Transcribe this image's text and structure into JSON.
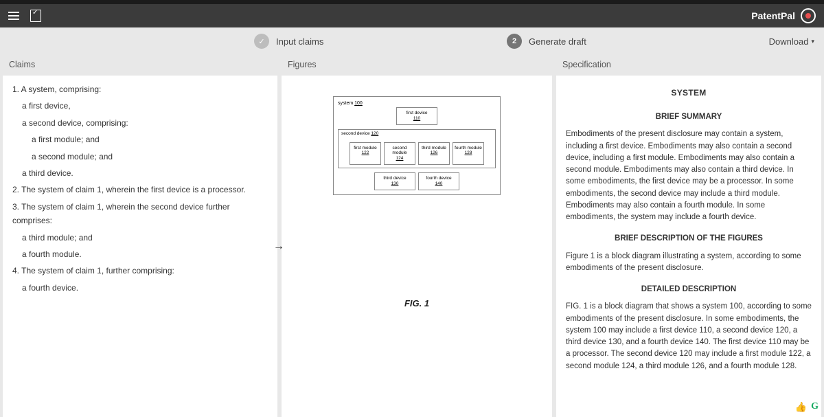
{
  "app": {
    "brand": "PatentPal"
  },
  "stepper": {
    "step1": {
      "label": "Input claims",
      "state": "done",
      "check": "✓"
    },
    "step2": {
      "label": "Generate draft",
      "state": "current",
      "number": "2"
    },
    "download": "Download"
  },
  "columns": {
    "claims_header": "Claims",
    "figures_header": "Figures",
    "spec_header": "Specification"
  },
  "claims": {
    "l1": "1. A system, comprising:",
    "l2": "a first device,",
    "l3": "a second device, comprising:",
    "l4": "a first module; and",
    "l5": "a second module; and",
    "l6": "a third device.",
    "l7": "2. The system of claim 1, wherein the first device is a processor.",
    "l8": "3. The system of claim 1, wherein the second device further comprises:",
    "l9": "a third module; and",
    "l10": "a fourth module.",
    "l11": "4. The system of claim 1, further comprising:",
    "l12": "a fourth device."
  },
  "figure": {
    "system_label": "system",
    "system_ref": "100",
    "first_device": "first device",
    "first_device_ref": "110",
    "second_device_label": "second device",
    "second_device_ref": "120",
    "m1": "first module",
    "m1r": "122",
    "m2": "second module",
    "m2r": "124",
    "m3": "third module",
    "m3r": "126",
    "m4": "fourth module",
    "m4r": "128",
    "third_device": "third device",
    "third_device_ref": "130",
    "fourth_device": "fourth device",
    "fourth_device_ref": "140",
    "caption": "FIG. 1"
  },
  "spec": {
    "title": "SYSTEM",
    "h_summary": "BRIEF SUMMARY",
    "summary": "Embodiments of the present disclosure may contain a system, including a first device. Embodiments may also contain a second device, including a first module. Embodiments may also contain a second module. Embodiments may also contain a third device. In some embodiments, the first device may be a processor. In some embodiments, the second device may include a third module. Embodiments may also contain a fourth module. In some embodiments, the system may include a fourth device.",
    "h_figures": "BRIEF DESCRIPTION OF THE FIGURES",
    "figures_p": "Figure 1 is a block diagram illustrating a system, according to some embodiments of the present disclosure.",
    "h_detailed": "DETAILED DESCRIPTION",
    "detailed_p": "FIG. 1 is a block diagram that shows a system 100, according to some embodiments of the present disclosure. In some embodiments, the system 100 may include a first device 110, a second device 120, a third device 130, and a fourth device 140. The first device 110 may be a processor. The second device 120 may include a first module 122, a second module 124, a third module 126, and a fourth module 128."
  },
  "icons": {
    "thumbs": "👍",
    "g": "G"
  }
}
